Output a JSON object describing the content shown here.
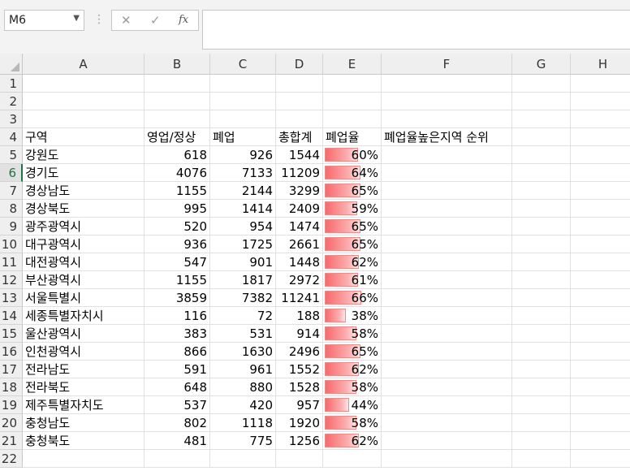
{
  "formula_bar": {
    "name_box": "M6",
    "separator": "⋮",
    "cancel_icon": "✕",
    "enter_icon": "✓",
    "fx_label": "fx",
    "formula": ""
  },
  "columns": [
    "A",
    "B",
    "C",
    "D",
    "E",
    "F",
    "G",
    "H"
  ],
  "row_numbers": [
    "1",
    "2",
    "3",
    "4",
    "5",
    "6",
    "7",
    "8",
    "9",
    "10",
    "11",
    "12",
    "13",
    "14",
    "15",
    "16",
    "17",
    "18",
    "19",
    "20",
    "21",
    "22"
  ],
  "selected_row": "6",
  "headers": [
    "구역",
    "영업/정상",
    "폐업",
    "총합계",
    "폐업율",
    "폐업율높은지역 순위"
  ],
  "rows": [
    {
      "region": "강원도",
      "open": "618",
      "closed": "926",
      "total": "1544",
      "rate": "60%",
      "rate_value": 0.6
    },
    {
      "region": "경기도",
      "open": "4076",
      "closed": "7133",
      "total": "11209",
      "rate": "64%",
      "rate_value": 0.64
    },
    {
      "region": "경상남도",
      "open": "1155",
      "closed": "2144",
      "total": "3299",
      "rate": "65%",
      "rate_value": 0.65
    },
    {
      "region": "경상북도",
      "open": "995",
      "closed": "1414",
      "total": "2409",
      "rate": "59%",
      "rate_value": 0.59
    },
    {
      "region": "광주광역시",
      "open": "520",
      "closed": "954",
      "total": "1474",
      "rate": "65%",
      "rate_value": 0.65
    },
    {
      "region": "대구광역시",
      "open": "936",
      "closed": "1725",
      "total": "2661",
      "rate": "65%",
      "rate_value": 0.65
    },
    {
      "region": "대전광역시",
      "open": "547",
      "closed": "901",
      "total": "1448",
      "rate": "62%",
      "rate_value": 0.62
    },
    {
      "region": "부산광역시",
      "open": "1155",
      "closed": "1817",
      "total": "2972",
      "rate": "61%",
      "rate_value": 0.61
    },
    {
      "region": "서울특별시",
      "open": "3859",
      "closed": "7382",
      "total": "11241",
      "rate": "66%",
      "rate_value": 0.66
    },
    {
      "region": "세종특별자치시",
      "open": "116",
      "closed": "72",
      "total": "188",
      "rate": "38%",
      "rate_value": 0.38
    },
    {
      "region": "울산광역시",
      "open": "383",
      "closed": "531",
      "total": "914",
      "rate": "58%",
      "rate_value": 0.58
    },
    {
      "region": "인천광역시",
      "open": "866",
      "closed": "1630",
      "total": "2496",
      "rate": "65%",
      "rate_value": 0.65
    },
    {
      "region": "전라남도",
      "open": "591",
      "closed": "961",
      "total": "1552",
      "rate": "62%",
      "rate_value": 0.62
    },
    {
      "region": "전라북도",
      "open": "648",
      "closed": "880",
      "total": "1528",
      "rate": "58%",
      "rate_value": 0.58
    },
    {
      "region": "제주특별자치도",
      "open": "537",
      "closed": "420",
      "total": "957",
      "rate": "44%",
      "rate_value": 0.44
    },
    {
      "region": "충청남도",
      "open": "802",
      "closed": "1118",
      "total": "1920",
      "rate": "58%",
      "rate_value": 0.58
    },
    {
      "region": "충청북도",
      "open": "481",
      "closed": "775",
      "total": "1256",
      "rate": "62%",
      "rate_value": 0.62
    }
  ],
  "colors": {
    "databar": "#f8696b",
    "databar_border": "#f08a8a",
    "selected_row_accent": "#217346"
  }
}
